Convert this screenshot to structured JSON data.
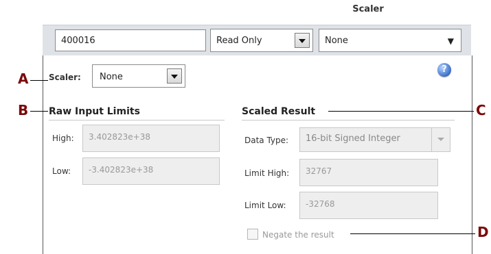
{
  "header": {
    "scaler_column": "Scaler"
  },
  "row": {
    "address_value": "400016",
    "access_value": "Read Only",
    "scaler_value": "None"
  },
  "panel": {
    "scaler_label": "Scaler:",
    "scaler_value": "None",
    "help_icon_glyph": "?",
    "raw_limits": {
      "title": "Raw Input Limits",
      "high_label": "High:",
      "high_value": "3.402823e+38",
      "low_label": "Low:",
      "low_value": "-3.402823e+38"
    },
    "scaled_result": {
      "title": "Scaled Result",
      "data_type_label": "Data Type:",
      "data_type_value": "16-bit Signed Integer",
      "limit_high_label": "Limit High:",
      "limit_high_value": "32767",
      "limit_low_label": "Limit Low:",
      "limit_low_value": "-32768",
      "negate_label": "Negate the result",
      "negate_checked": false
    }
  },
  "callouts": {
    "a": "A",
    "b": "B",
    "c": "C",
    "d": "D"
  },
  "icons": {
    "dropdown": "chevron-down-icon",
    "help": "help-icon",
    "checkbox": "checkbox-icon"
  }
}
